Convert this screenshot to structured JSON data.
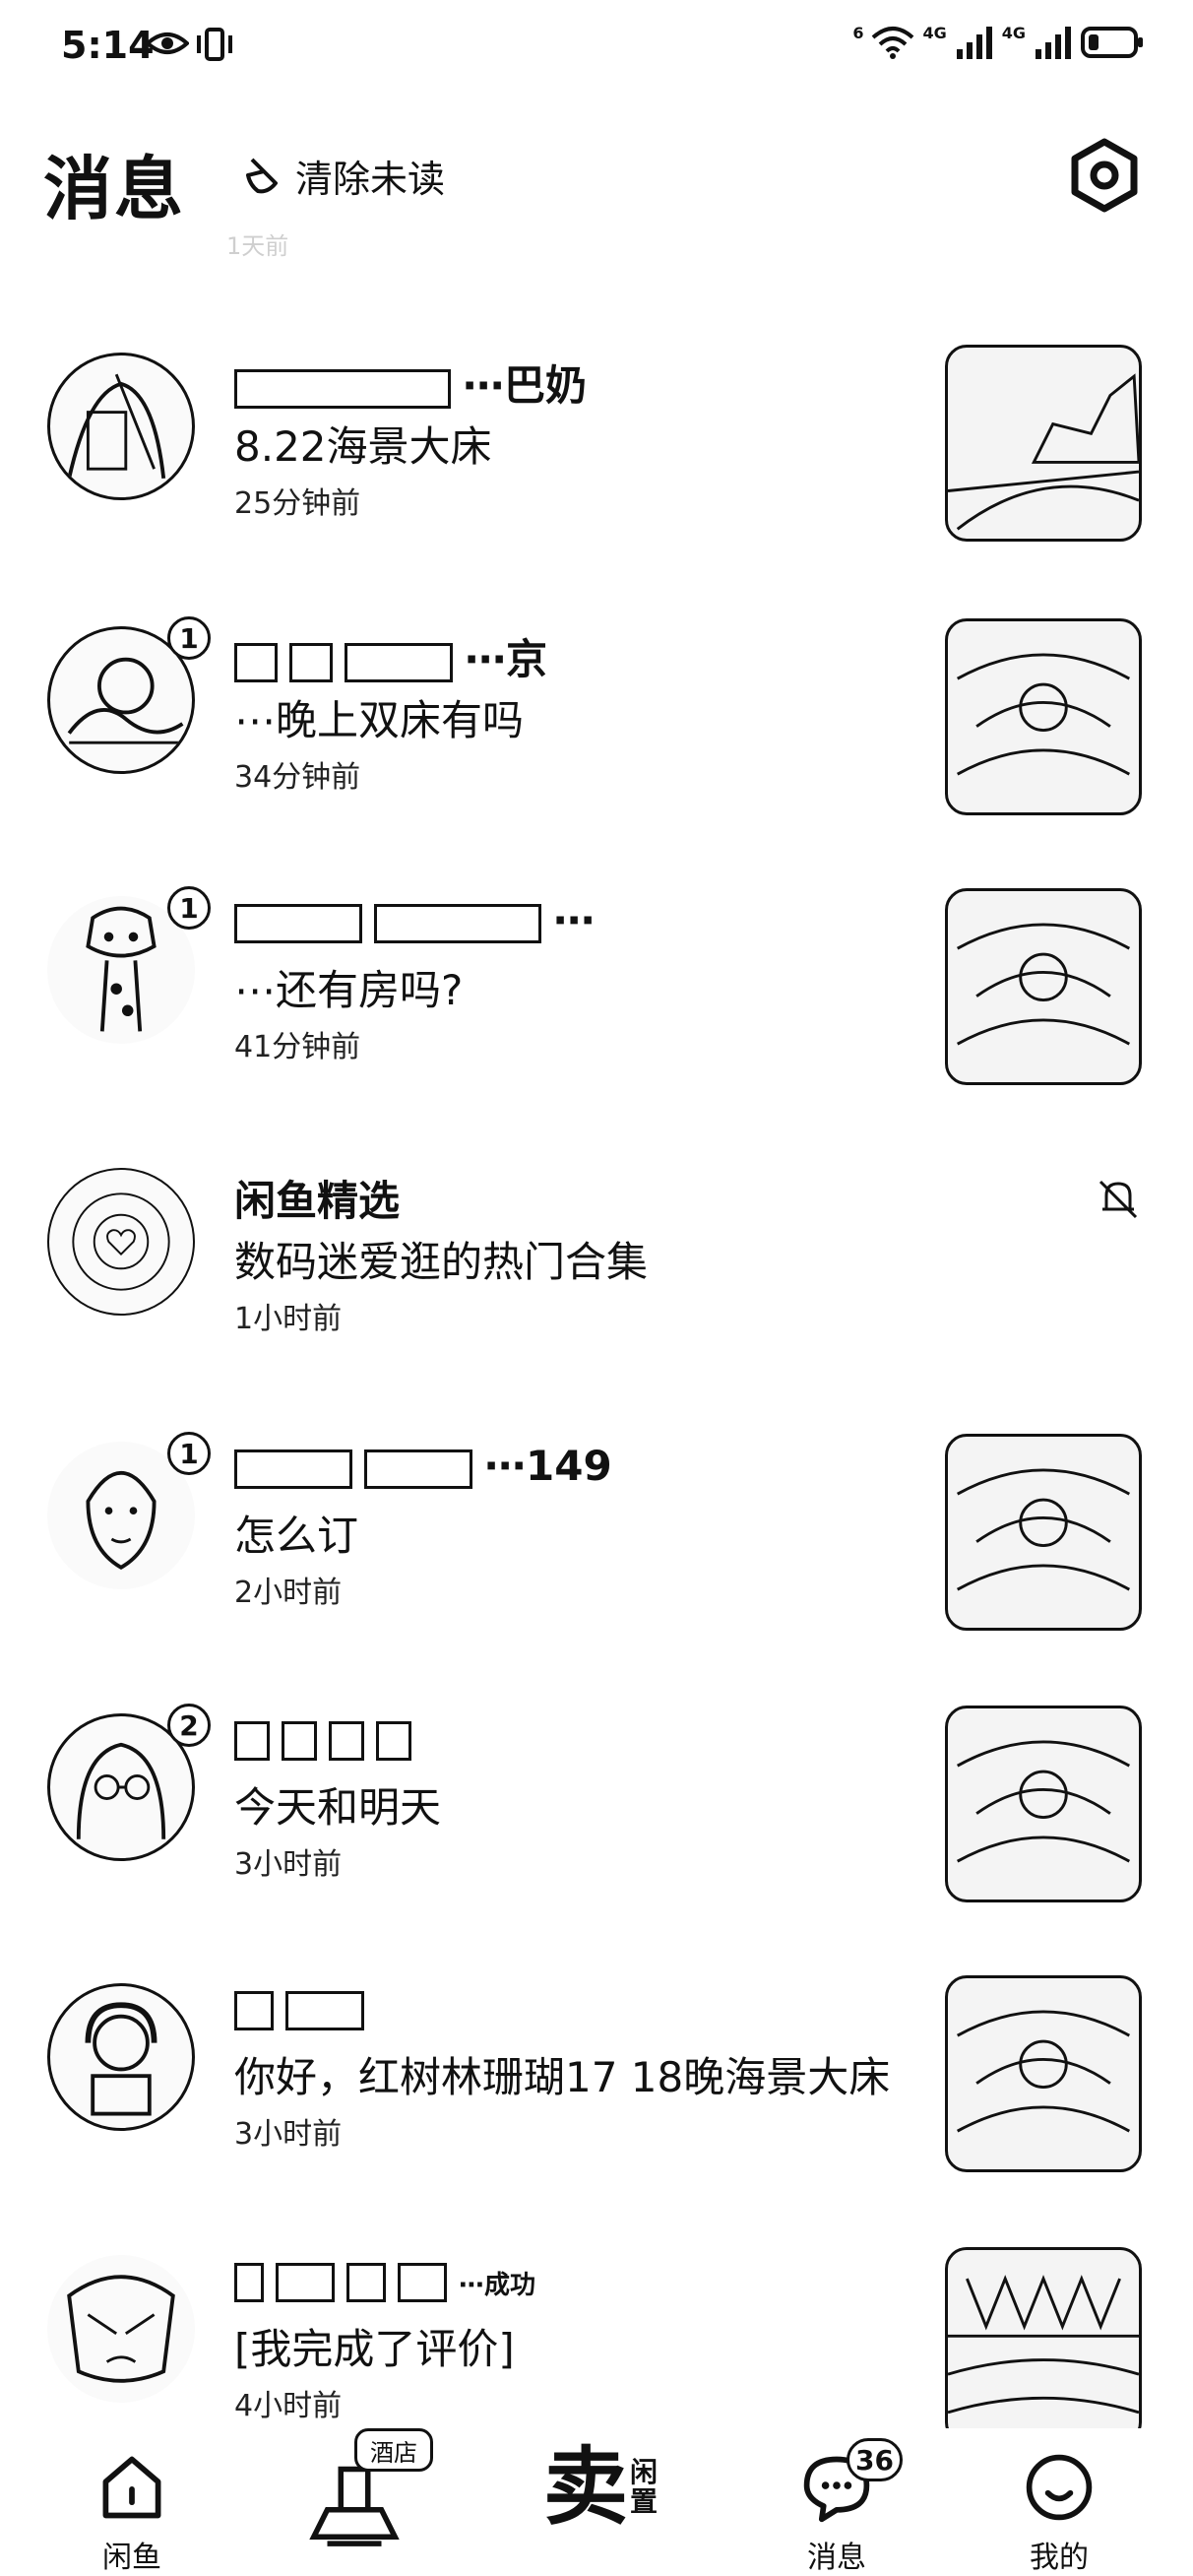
{
  "status": {
    "time": "5:14",
    "net1": "6",
    "net2": "4G",
    "net3": "4G"
  },
  "header": {
    "title": "消息",
    "clear_label": "清除未读",
    "faded_text": "1天前"
  },
  "conversations": [
    {
      "name": "⋯巴奶",
      "message": "8.22海景大床",
      "time": "25分钟前",
      "badge": ""
    },
    {
      "name": "⋯京",
      "message": "⋯晚上双床有吗",
      "time": "34分钟前",
      "badge": "1"
    },
    {
      "name": "⋯",
      "message": "⋯还有房吗?",
      "time": "41分钟前",
      "badge": "1"
    },
    {
      "name": "闲鱼精选",
      "message": "数码迷爱逛的热门合集",
      "time": "1小时前",
      "badge": ""
    },
    {
      "name": "⋯149",
      "message": "怎么订",
      "time": "2小时前",
      "badge": "1"
    },
    {
      "name": "",
      "message": "今天和明天",
      "time": "3小时前",
      "badge": "2"
    },
    {
      "name": "",
      "message": "你好，红树林珊瑚17 18晚海景大床",
      "time": "3小时前",
      "badge": ""
    },
    {
      "name": "⋯成功",
      "message": "[我完成了评价]",
      "time": "4小时前",
      "badge": ""
    }
  ],
  "nav": {
    "home_label": "闲鱼",
    "hotel_tag": "酒店",
    "sell_main": "卖",
    "sell_sub": "闲置",
    "messages_label": "消息",
    "messages_badge": "36",
    "me_label": "我的"
  }
}
